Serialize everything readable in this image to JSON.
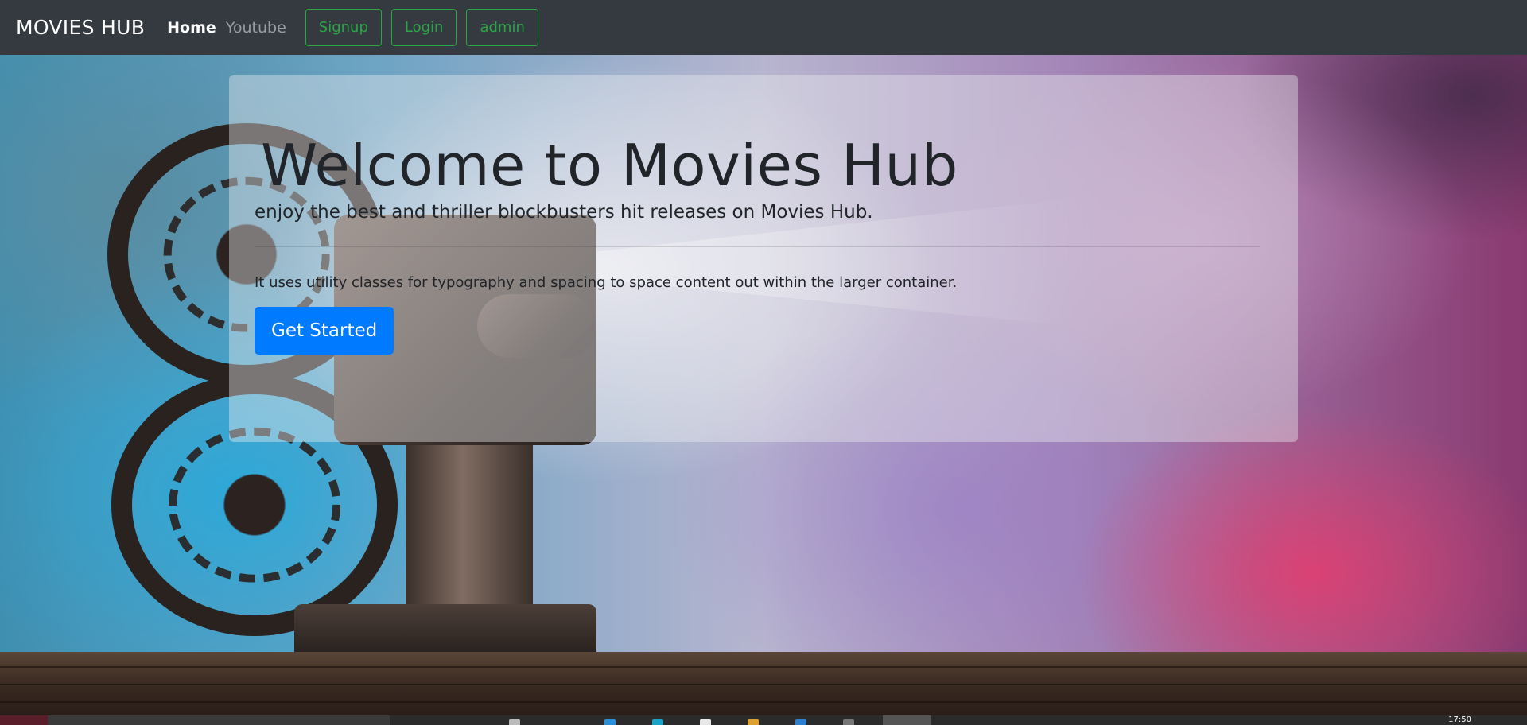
{
  "navbar": {
    "brand": "MOVIES HUB",
    "links": [
      {
        "label": "Home"
      },
      {
        "label": "Youtube"
      }
    ],
    "buttons": [
      {
        "label": "Signup"
      },
      {
        "label": "Login"
      },
      {
        "label": "admin"
      }
    ]
  },
  "jumbotron": {
    "title": "Welcome to Movies Hub",
    "lead": "enjoy the best and thriller blockbusters hit releases on Movies Hub.",
    "body": "It uses utility classes for typography and spacing to space content out within the larger container.",
    "cta_label": "Get Started"
  },
  "taskbar": {
    "clock": "17:50"
  },
  "colors": {
    "navbar_bg": "#343a40",
    "outline_success": "#28a745",
    "primary": "#007bff"
  }
}
